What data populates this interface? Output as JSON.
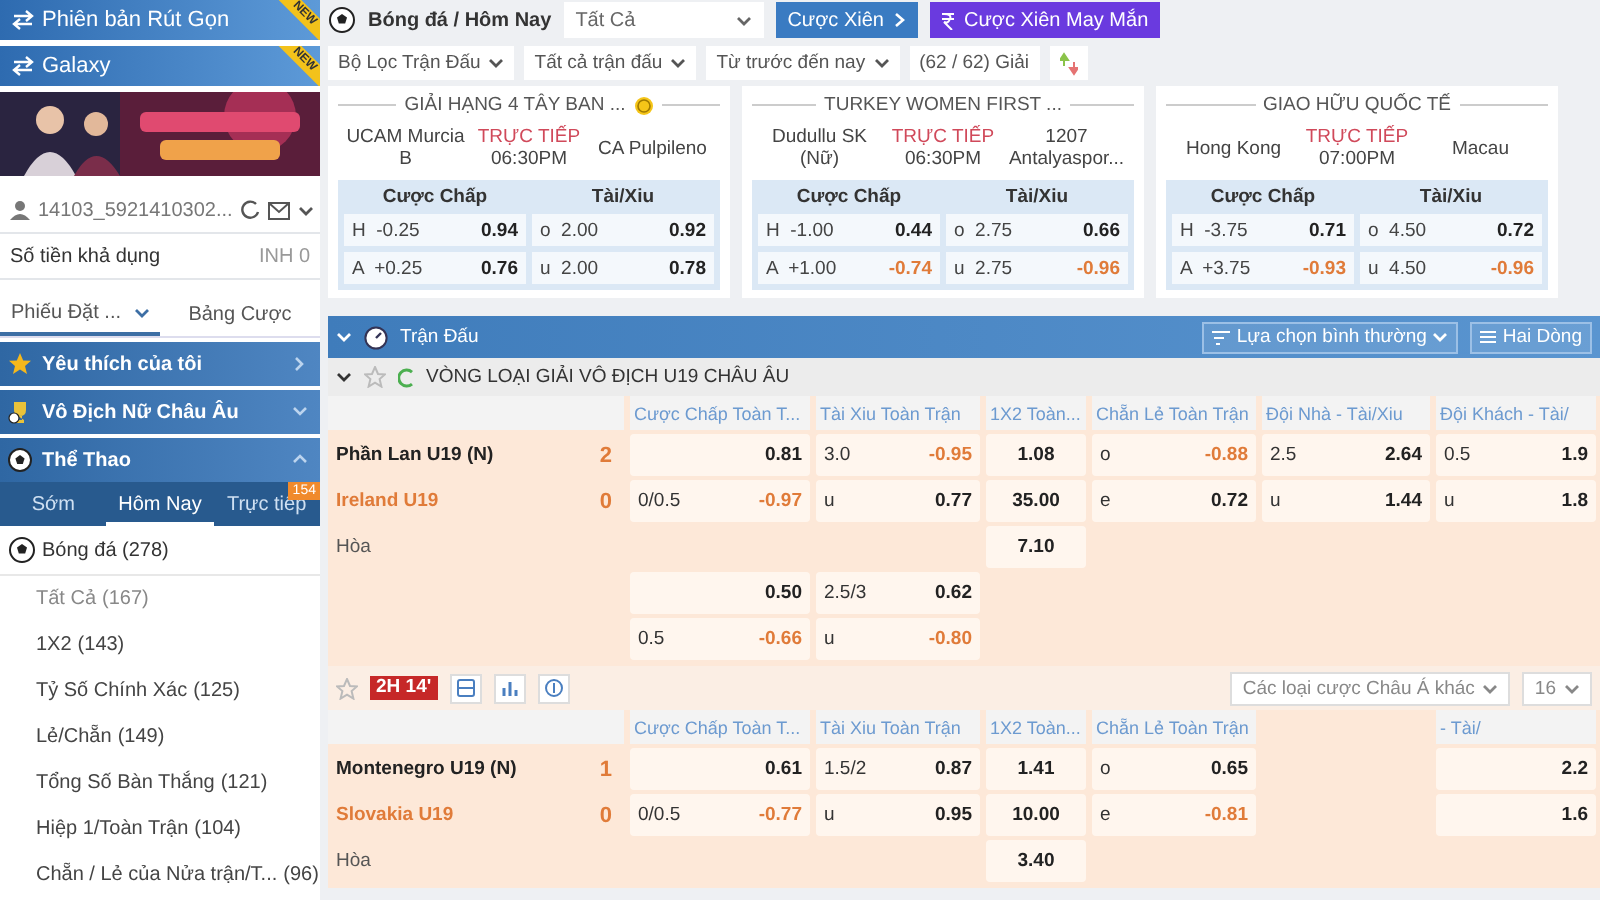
{
  "sidebar": {
    "promos": [
      {
        "label": "Phiên bản Rút Gọn",
        "badge": "NEW"
      },
      {
        "label": "Galaxy",
        "badge": "NEW"
      }
    ],
    "account": {
      "user": "14103_5921410302...",
      "balance_label": "Số tiền khả dụng",
      "balance": "INH 0"
    },
    "tabs": [
      {
        "label": "Phiếu Đặt ...",
        "kind": "dropdown",
        "selected": true
      },
      {
        "label": "Bảng Cược",
        "kind": "plain",
        "selected": false
      }
    ],
    "sections": [
      {
        "label": "Yêu thích của tôi",
        "kind": "link"
      },
      {
        "label": "Vô Địch Nữ Châu Âu",
        "kind": "collapsed"
      },
      {
        "label": "Thể Thao",
        "kind": "expanded"
      }
    ],
    "sport_tabs": [
      {
        "label": "Sớm",
        "selected": false
      },
      {
        "label": "Hôm Nay",
        "selected": true
      },
      {
        "label": "Trực tiếp",
        "selected": false,
        "badge": "154"
      }
    ],
    "sport": {
      "label": "Bóng đá",
      "count": "(278)"
    },
    "markets": [
      {
        "label": "Tất Cả",
        "count": "(167)",
        "selected": true
      },
      {
        "label": "1X2",
        "count": "(143)",
        "selected": false
      },
      {
        "label": "Tỷ Số Chính Xác",
        "count": "(125)",
        "selected": false
      },
      {
        "label": "Lẻ/Chẵn",
        "count": "(149)",
        "selected": false
      },
      {
        "label": "Tổng Số Bàn Thắng",
        "count": "(121)",
        "selected": false
      },
      {
        "label": "Hiệp 1/Toàn Trận",
        "count": "(104)",
        "selected": false
      },
      {
        "label": "Chẵn / Lẻ của Nửa trận/T...",
        "count": "(96)",
        "selected": false
      }
    ]
  },
  "topbar": {
    "crumb": "Bóng đá / Hôm Nay",
    "select": "Tất Cả",
    "buttons": [
      {
        "label": "Cược Xiên",
        "kind": "parlay"
      },
      {
        "label": "Cược Xiên May Mắn",
        "kind": "lucky"
      }
    ]
  },
  "filters": [
    {
      "label": "Bộ Lọc Trận Đấu",
      "kind": "dropdown"
    },
    {
      "label": "Tất cả trận đấu",
      "kind": "dropdown"
    },
    {
      "label": "Từ trước đến nay",
      "kind": "dropdown"
    },
    {
      "label": "(62 / 62) Giải",
      "kind": "plain"
    },
    {
      "kind": "sort"
    }
  ],
  "cards": [
    {
      "league": "GIẢI HẠNG 4 TÂY BAN ...",
      "coin": true,
      "home": "UCAM Murcia B",
      "status": "TRỰC TIẾP",
      "time": "06:30PM",
      "away": "CA Pulpileno",
      "headers": [
        "Cược Chấp",
        "Tài/Xiu"
      ],
      "handicap": [
        {
          "side": "H",
          "line": "-0.25",
          "odds": "0.94",
          "negative": false
        },
        {
          "side": "A",
          "line": "+0.25",
          "odds": "0.76",
          "negative": false
        }
      ],
      "totals": [
        {
          "side": "o",
          "line": "2.00",
          "odds": "0.92",
          "negative": false
        },
        {
          "side": "u",
          "line": "2.00",
          "odds": "0.78",
          "negative": false
        }
      ]
    },
    {
      "league": "TURKEY WOMEN FIRST ...",
      "coin": false,
      "home": "Dudullu SK (Nữ)",
      "status": "TRỰC TIẾP",
      "time": "06:30PM",
      "away": "1207 Antalyaspor...",
      "headers": [
        "Cược Chấp",
        "Tài/Xiu"
      ],
      "handicap": [
        {
          "side": "H",
          "line": "-1.00",
          "odds": "0.44",
          "negative": false
        },
        {
          "side": "A",
          "line": "+1.00",
          "odds": "-0.74",
          "negative": true
        }
      ],
      "totals": [
        {
          "side": "o",
          "line": "2.75",
          "odds": "0.66",
          "negative": false
        },
        {
          "side": "u",
          "line": "2.75",
          "odds": "-0.96",
          "negative": true
        }
      ]
    },
    {
      "league": "GIAO HỮU QUỐC TẾ",
      "coin": false,
      "home": "Hong Kong",
      "status": "TRỰC TIẾP",
      "time": "07:00PM",
      "away": "Macau",
      "headers": [
        "Cược Chấp",
        "Tài/Xiu"
      ],
      "handicap": [
        {
          "side": "H",
          "line": "-3.75",
          "odds": "0.71",
          "negative": false
        },
        {
          "side": "A",
          "line": "+3.75",
          "odds": "-0.93",
          "negative": true
        }
      ],
      "totals": [
        {
          "side": "o",
          "line": "4.50",
          "odds": "0.72",
          "negative": false
        },
        {
          "side": "u",
          "line": "4.50",
          "odds": "-0.96",
          "negative": true
        }
      ]
    }
  ],
  "panel": {
    "title": "Trận Đấu",
    "view_select": "Lựa chọn bình thường",
    "layout_select": "Hai Dòng",
    "league": "VÒNG LOẠI GIẢI VÔ ĐỊCH U19 CHÂU ÂU",
    "matches": [
      {
        "columns": [
          "Cược Chấp Toàn T...",
          "Tài Xiu Toàn Trận",
          "1X2 Toàn...",
          "Chẵn Lẻ Toàn Trận",
          "Đội Nhà - Tài/Xiu",
          "Đội Khách - Tài/"
        ],
        "rows": [
          {
            "team": "Phần Lan U19 (N)",
            "kind": "home",
            "score": "2",
            "cells": [
              {
                "odds": "0.81",
                "negative": false
              },
              {
                "line": "3.0",
                "odds": "-0.95",
                "negative": true
              },
              {
                "odds": "1.08",
                "negative": false
              },
              {
                "line": "o",
                "odds": "-0.88",
                "negative": true
              },
              {
                "line": "2.5",
                "odds": "2.64",
                "negative": false
              },
              {
                "line": "0.5",
                "odds": "1.9",
                "negative": false
              }
            ]
          },
          {
            "team": "Ireland U19",
            "kind": "away",
            "score": "0",
            "cells": [
              {
                "line": "0/0.5",
                "odds": "-0.97",
                "negative": true
              },
              {
                "line": "u",
                "odds": "0.77",
                "negative": false
              },
              {
                "odds": "35.00",
                "negative": false
              },
              {
                "line": "e",
                "odds": "0.72",
                "negative": false
              },
              {
                "line": "u",
                "odds": "1.44",
                "negative": false
              },
              {
                "line": "u",
                "odds": "1.8",
                "negative": false
              }
            ]
          },
          {
            "team": "Hòa",
            "kind": "draw",
            "cells": [
              null,
              null,
              {
                "odds": "7.10",
                "negative": false
              },
              null,
              null,
              null
            ]
          },
          {
            "kind": "extra",
            "cells": [
              {
                "odds": "0.50",
                "negative": false
              },
              {
                "line": "2.5/3",
                "odds": "0.62",
                "negative": false
              },
              null,
              null,
              null,
              null
            ]
          },
          {
            "kind": "extra",
            "cells": [
              {
                "line": "0.5",
                "odds": "-0.66",
                "negative": true
              },
              {
                "line": "u",
                "odds": "-0.80",
                "negative": true
              },
              null,
              null,
              null,
              null
            ]
          }
        ],
        "footer": {
          "clock": "2H 14'",
          "market_select": "Các loại cược Châu Á khác",
          "count_select": "16"
        }
      },
      {
        "columns": [
          "Cược Chấp Toàn T...",
          "Tài Xiu Toàn Trận",
          "1X2 Toàn...",
          "Chẵn Lẻ Toàn Trận",
          null,
          "- Tài/"
        ],
        "rows": [
          {
            "team": "Montenegro U19 (N)",
            "kind": "home",
            "score": "1",
            "cells": [
              {
                "odds": "0.61",
                "negative": false
              },
              {
                "line": "1.5/2",
                "odds": "0.87",
                "negative": false
              },
              {
                "odds": "1.41",
                "negative": false
              },
              {
                "line": "o",
                "odds": "0.65",
                "negative": false
              },
              null,
              {
                "odds": "2.2",
                "negative": false
              }
            ]
          },
          {
            "team": "Slovakia U19",
            "kind": "away",
            "score": "0",
            "cells": [
              {
                "line": "0/0.5",
                "odds": "-0.77",
                "negative": true
              },
              {
                "line": "u",
                "odds": "0.95",
                "negative": false
              },
              {
                "odds": "10.00",
                "negative": false
              },
              {
                "line": "e",
                "odds": "-0.81",
                "negative": true
              },
              null,
              {
                "odds": "1.6",
                "negative": false
              }
            ]
          },
          {
            "team": "Hòa",
            "kind": "draw",
            "cells": [
              null,
              null,
              {
                "odds": "3.40",
                "negative": false
              },
              null,
              null,
              null
            ]
          }
        ]
      }
    ]
  }
}
